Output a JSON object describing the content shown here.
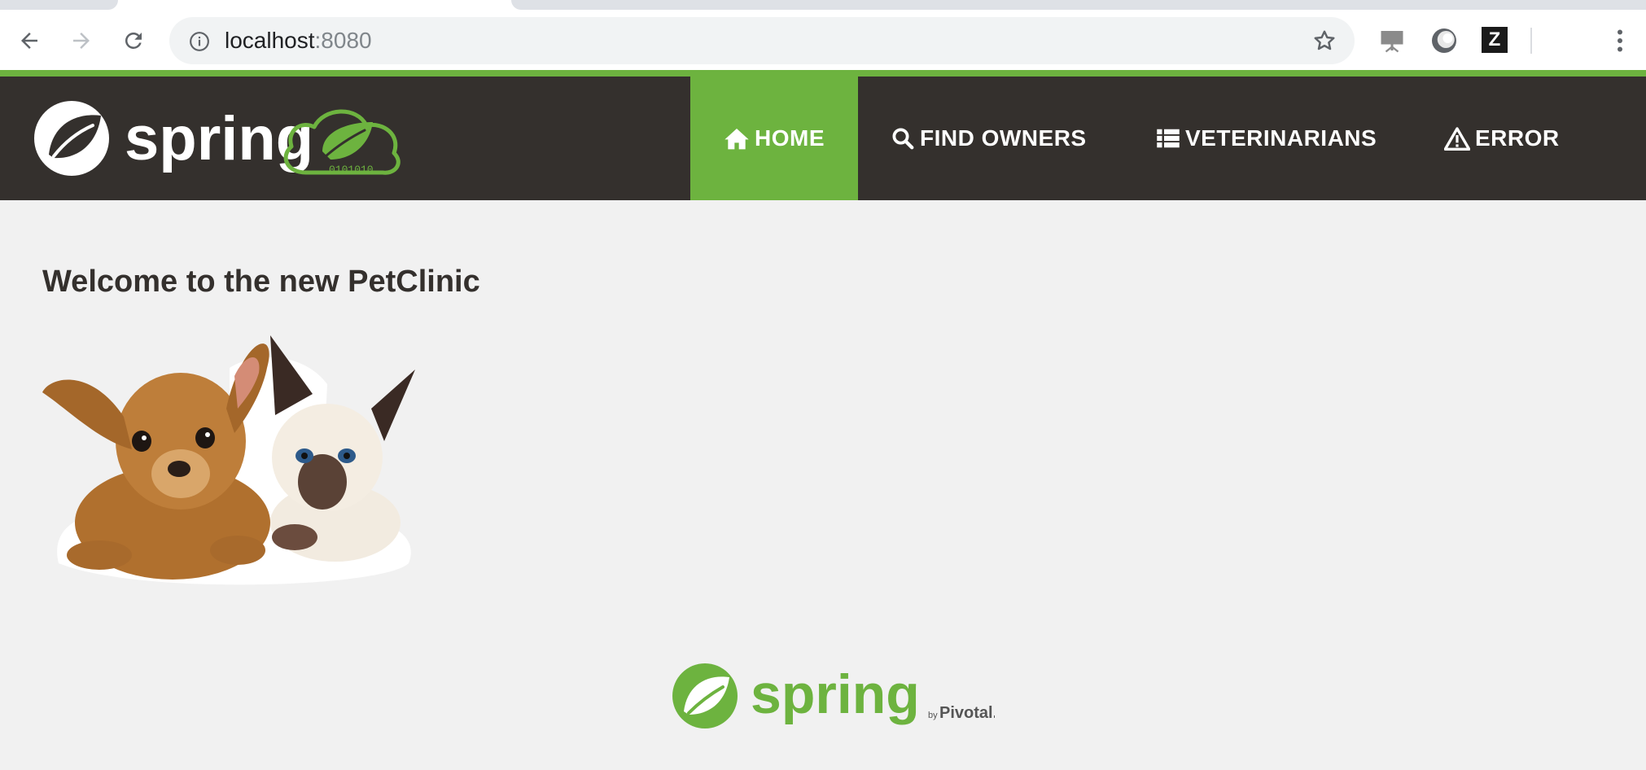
{
  "browser": {
    "url_host": "localhost",
    "url_port": ":8080"
  },
  "navbar": {
    "brand_text": "spring",
    "cloud_digits": "0101010",
    "items": [
      {
        "label": "HOME",
        "icon": "home-icon",
        "active": true
      },
      {
        "label": "FIND OWNERS",
        "icon": "search-icon",
        "active": false
      },
      {
        "label": "VETERINARIANS",
        "icon": "list-icon",
        "active": false
      },
      {
        "label": "ERROR",
        "icon": "warning-icon",
        "active": false
      }
    ]
  },
  "main": {
    "title": "Welcome to the new PetClinic"
  },
  "footer": {
    "brand_text": "spring",
    "by_text": "by",
    "pivotal_text": "Pivotal."
  },
  "colors": {
    "spring_green": "#6db33f",
    "navbar_dark": "#34302d",
    "page_bg": "#f1f1f1"
  }
}
